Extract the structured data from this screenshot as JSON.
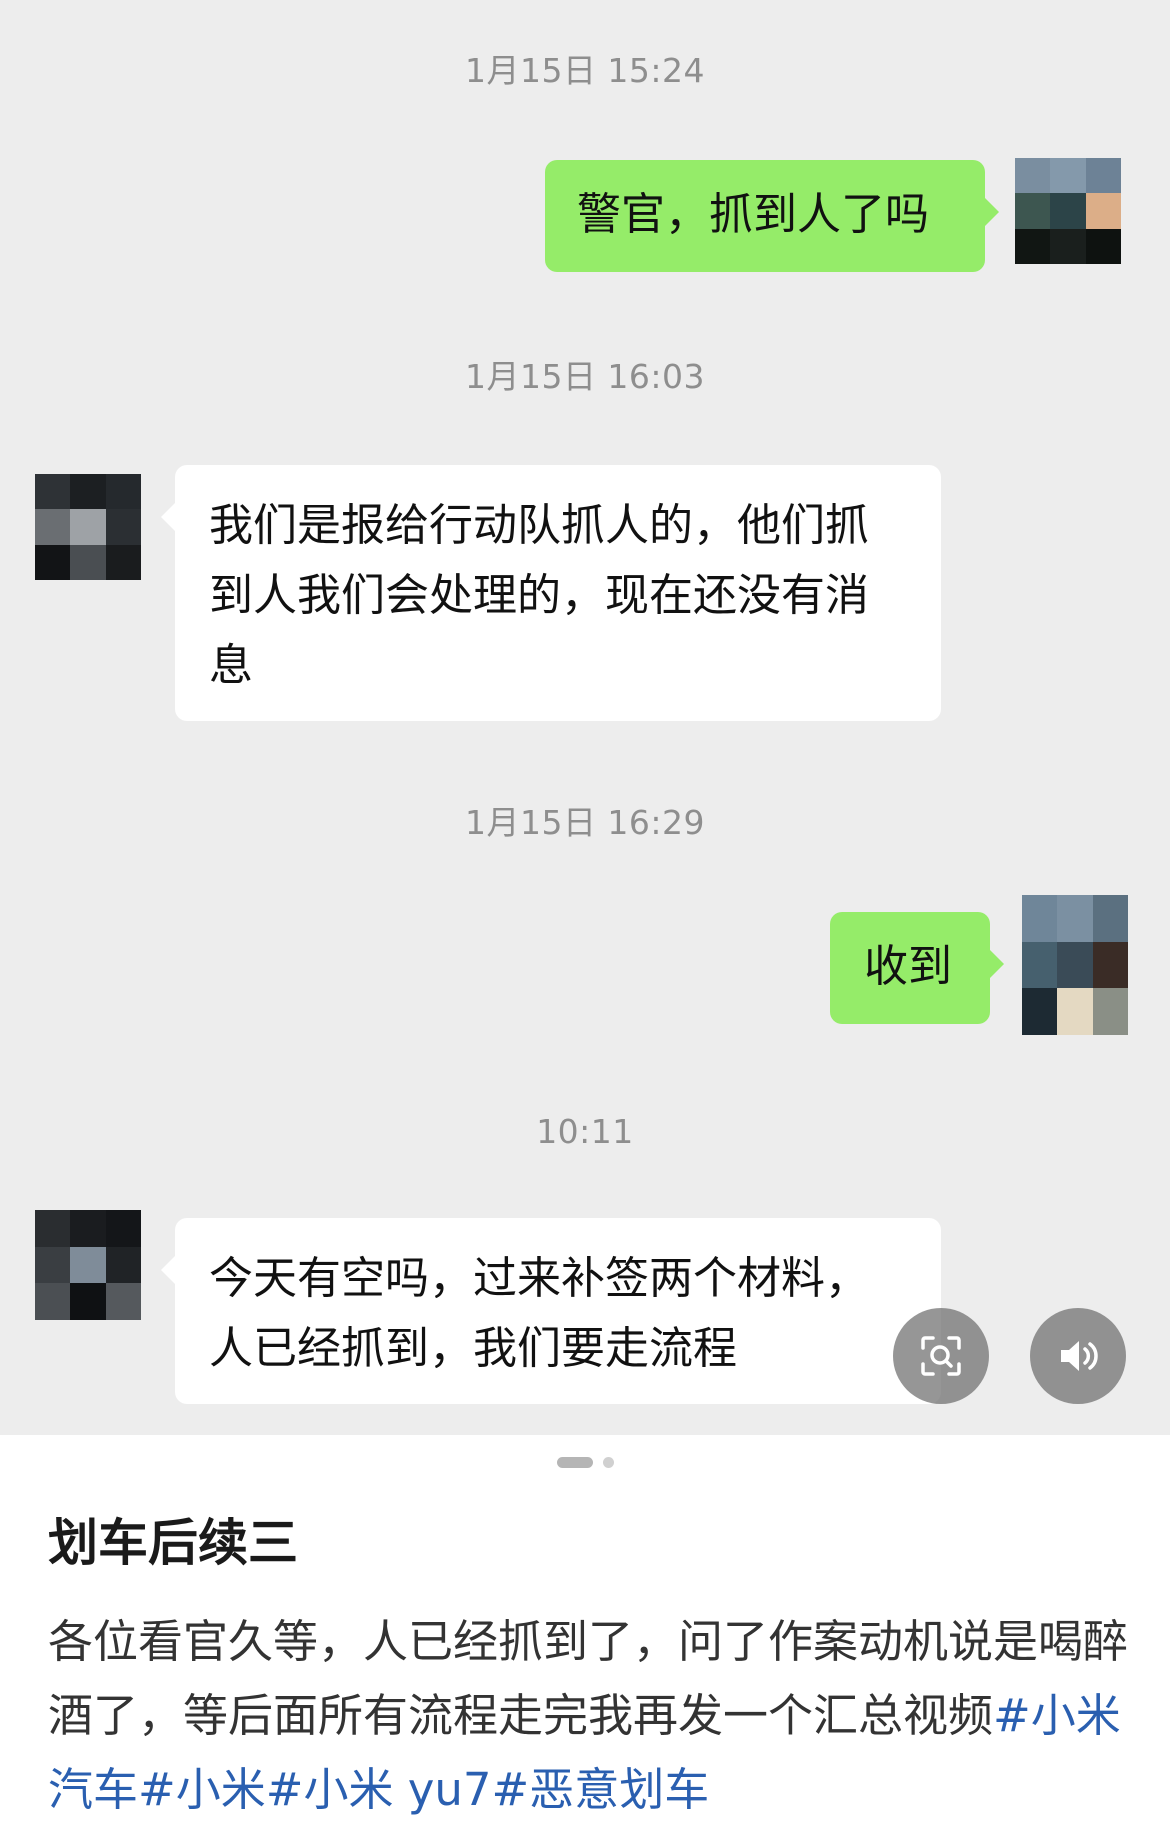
{
  "chat": {
    "messages": [
      {
        "timestamp": "1月15日 15:24",
        "sender": "me",
        "text": "警官，抓到人了吗"
      },
      {
        "timestamp": "1月15日 16:03",
        "sender": "them",
        "text": "我们是报给行动队抓人的，他们抓到人我们会处理的，现在还没有消息"
      },
      {
        "timestamp": "1月15日 16:29",
        "sender": "me",
        "text": "收到"
      },
      {
        "timestamp": "10:11",
        "sender": "them",
        "text": "今天有空吗，过来补签两个材料，人已经抓到，我们要走流程"
      }
    ],
    "buttons": {
      "scan_icon": "scan-search-icon",
      "speaker_icon": "speaker-icon"
    }
  },
  "post": {
    "title": "划车后续三",
    "body": "各位看官久等，人已经抓到了，问了作案动机说是喝醉酒了，等后面所有流程走完我再发一个汇总视频",
    "tags": [
      "#小米汽车",
      "#小米",
      "#小米 yu7",
      "#恶意划车"
    ]
  },
  "colors": {
    "chat_bg": "#ededed",
    "my_bubble": "#95ec69",
    "their_bubble": "#ffffff",
    "tag_link": "#2a5fb0"
  }
}
